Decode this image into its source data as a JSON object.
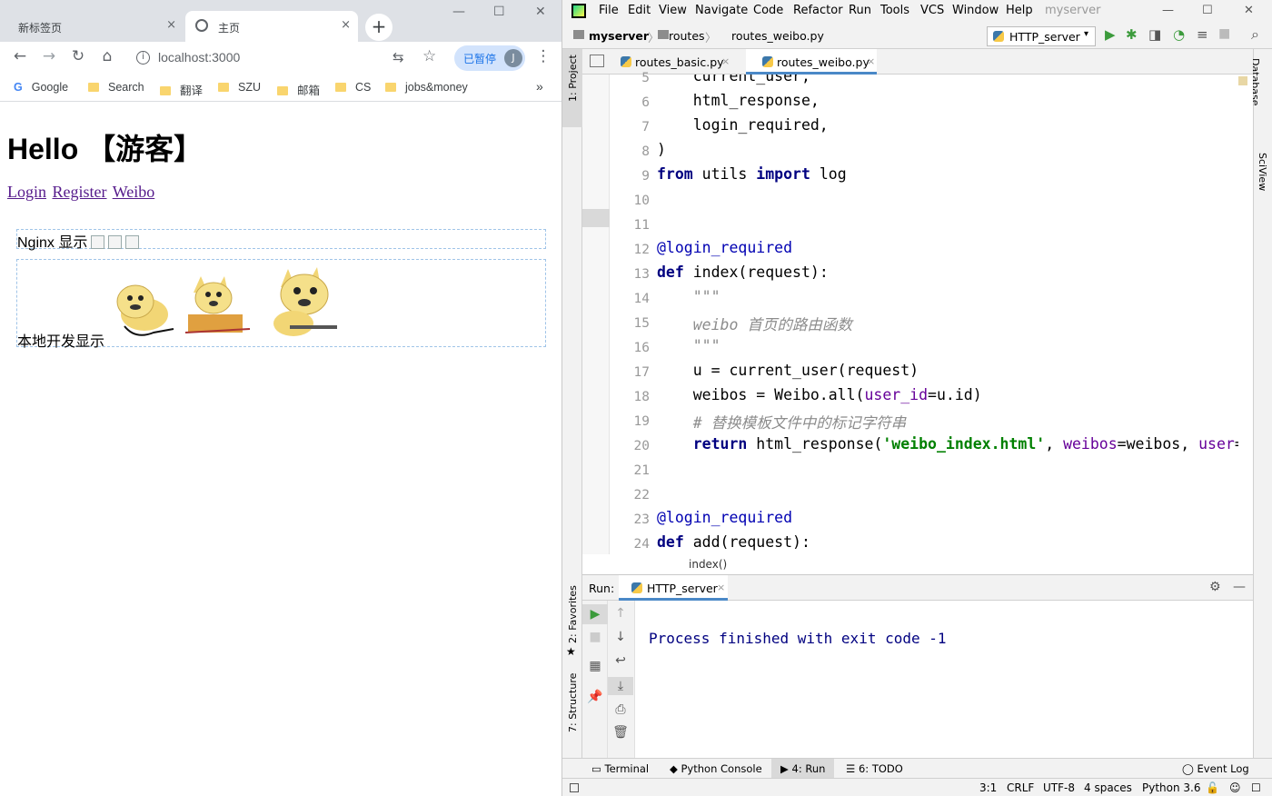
{
  "browser": {
    "tabs": [
      {
        "title": "新标签页",
        "close": "×"
      },
      {
        "title": "主页",
        "close": "×"
      }
    ],
    "new_tab": "+",
    "window_controls": {
      "minimize": "—",
      "maximize": "☐",
      "close": "✕"
    },
    "url": "localhost:3000",
    "paused_label": "已暂停",
    "profile_initial": "J",
    "bookmarks": [
      "Google",
      "Search",
      "翻译",
      "SZU",
      "邮箱",
      "CS",
      "jobs&money"
    ],
    "bookmarks_more": "»"
  },
  "page": {
    "heading": "Hello 【游客】",
    "links": [
      "Login",
      "Register",
      "Weibo"
    ],
    "nginx_label": "Nginx 显示",
    "local_label": "本地开发显示"
  },
  "ide": {
    "menu": [
      "File",
      "Edit",
      "View",
      "Navigate",
      "Code",
      "Refactor",
      "Run",
      "Tools",
      "VCS",
      "Window",
      "Help"
    ],
    "project_name": "myserver",
    "breadcrumb": [
      "myserver",
      "routes",
      "routes_weibo.py"
    ],
    "run_config": "HTTP_server",
    "editor_tabs": [
      {
        "label": "routes_basic.py",
        "active": false
      },
      {
        "label": "routes_weibo.py",
        "active": true
      }
    ],
    "side_tools": {
      "project": "1: Project",
      "favorites": "2: Favorites",
      "structure": "7: Structure",
      "database": "Database",
      "sciview": "SciView"
    },
    "code_lines": [
      {
        "n": "5",
        "html": "    current_user,"
      },
      {
        "n": "6",
        "html": "    html_response,"
      },
      {
        "n": "7",
        "html": "    login_required,"
      },
      {
        "n": "8",
        "html": ")"
      },
      {
        "n": "9",
        "html": "<span class=\"kw\">from</span> utils <span class=\"kw\">import</span> log"
      },
      {
        "n": "10",
        "html": ""
      },
      {
        "n": "11",
        "html": ""
      },
      {
        "n": "12",
        "html": "<span class=\"dec\">@login_required</span>"
      },
      {
        "n": "13",
        "html": "<span class=\"kw\">def</span> index(request):"
      },
      {
        "n": "14",
        "html": "    <span class=\"doc\">\"\"\"</span>"
      },
      {
        "n": "15",
        "html": "    <span class=\"doc\">weibo 首页的路由函数</span>"
      },
      {
        "n": "16",
        "html": "    <span class=\"doc\">\"\"\"</span>"
      },
      {
        "n": "17",
        "html": "    u = current_user(request)"
      },
      {
        "n": "18",
        "html": "    weibos = Weibo.all(<span class=\"kwarg\">user_id</span>=u.id)"
      },
      {
        "n": "19",
        "html": "    <span class=\"cmt\"># 替换模板文件中的标记字符串</span>"
      },
      {
        "n": "20",
        "html": "    <span class=\"kw\">return</span> html_response(<span class=\"str\">'weibo_index.html'</span>, <span class=\"kwarg\">weibos</span>=weibos, <span class=\"kwarg\">user</span>=u)"
      },
      {
        "n": "21",
        "html": ""
      },
      {
        "n": "22",
        "html": ""
      },
      {
        "n": "23",
        "html": "<span class=\"dec\">@login_required</span>"
      },
      {
        "n": "24",
        "html": "<span class=\"kw\">def</span> add(request):"
      }
    ],
    "code_breadcrumb": "index()",
    "run_label": "Run:",
    "run_tab": "HTTP_server",
    "output": "Process finished with exit code -1",
    "bottom_tabs": [
      "Terminal",
      "Python Console",
      "4: Run",
      "6: TODO"
    ],
    "event_log": "Event Log",
    "status": {
      "position": "3:1",
      "line_sep": "CRLF",
      "encoding": "UTF-8",
      "indent": "4 spaces",
      "interpreter": "Python 3.6"
    }
  }
}
